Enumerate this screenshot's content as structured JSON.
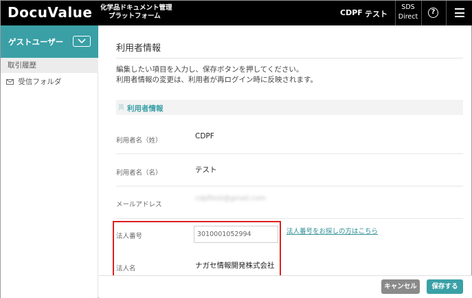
{
  "header": {
    "logo": "DocuValue",
    "tagline_line1": "化学品ドキュメント管理",
    "tagline_line2": "プラットフォーム",
    "company": "CDPF",
    "user_name": "テスト",
    "sds_line1": "SDS",
    "sds_line2": "Direct",
    "help_glyph": "?"
  },
  "sidebar": {
    "user_label": "ゲストユーザー",
    "items": [
      {
        "label": "取引履歴"
      },
      {
        "label": "受信フォルダ"
      }
    ]
  },
  "main": {
    "title": "利用者情報",
    "desc_line1": "編集したい項目を入力し、保存ボタンを押してください。",
    "desc_line2": "利用者情報の変更は、利用者が再ログイン時に反映されます。",
    "section_title": "利用者情報",
    "fields": {
      "last_name": {
        "label": "利用者名（姓）",
        "value": "CDPF"
      },
      "first_name": {
        "label": "利用者名（名）",
        "value": "テスト"
      },
      "email": {
        "label": "メールアドレス",
        "value": "cdpftest@gmail.com"
      },
      "corp_number": {
        "label": "法人番号",
        "value": "3010001052994"
      },
      "corp_name": {
        "label": "法人名",
        "value": "ナガセ情報開発株式会社"
      }
    },
    "corp_search_link": "法人番号をお探しの方はこちら"
  },
  "footer": {
    "cancel_label": "キャンセル",
    "save_label": "保存する"
  },
  "colors": {
    "accent": "#3aa0a6",
    "header_bg": "#000000",
    "highlight": "#e01e1e",
    "cancel_bg": "#8a8a8a"
  }
}
